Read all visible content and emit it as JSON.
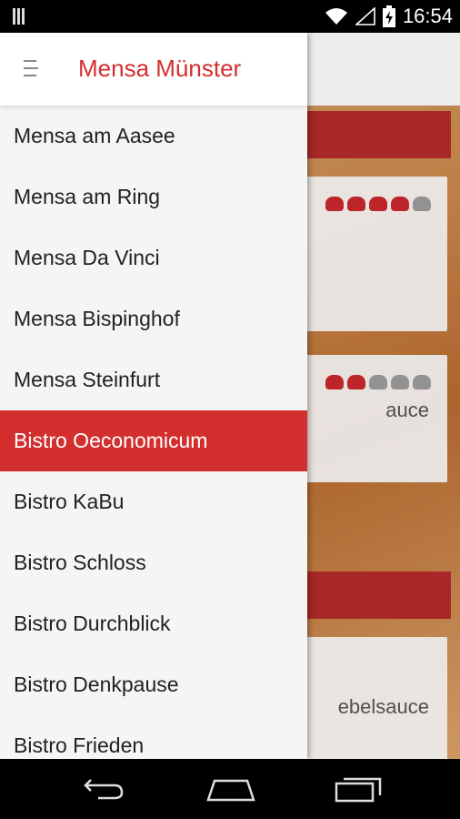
{
  "status_bar": {
    "time": "16:54",
    "icons": [
      "barcode-icon",
      "wifi-icon",
      "signal-icon",
      "battery-charging-icon"
    ]
  },
  "drawer": {
    "title": "Mensa Münster",
    "menu_icon": "hamburger-icon",
    "items": [
      {
        "label": "Mensa am Aasee",
        "selected": false
      },
      {
        "label": "Mensa am Ring",
        "selected": false
      },
      {
        "label": "Mensa Da Vinci",
        "selected": false
      },
      {
        "label": "Mensa Bispinghof",
        "selected": false
      },
      {
        "label": "Mensa Steinfurt",
        "selected": false
      },
      {
        "label": "Bistro Oeconomicum",
        "selected": true
      },
      {
        "label": "Bistro KaBu",
        "selected": false
      },
      {
        "label": "Bistro Schloss",
        "selected": false
      },
      {
        "label": "Bistro Durchblick",
        "selected": false
      },
      {
        "label": "Bistro Denkpause",
        "selected": false
      },
      {
        "label": "Bistro Frieden",
        "selected": false
      }
    ]
  },
  "background": {
    "meals": [
      {
        "rating": 4,
        "rating_max": 5
      },
      {
        "text": "auce",
        "rating": 2,
        "rating_max": 5
      },
      {
        "text": "ebelsauce",
        "rating": 0,
        "rating_max": 5
      }
    ]
  },
  "nav_bar": {
    "icons": [
      "back-icon",
      "home-icon",
      "recents-icon"
    ]
  },
  "colors": {
    "accent": "#d32f2f",
    "day_header": "#b12a2a"
  }
}
